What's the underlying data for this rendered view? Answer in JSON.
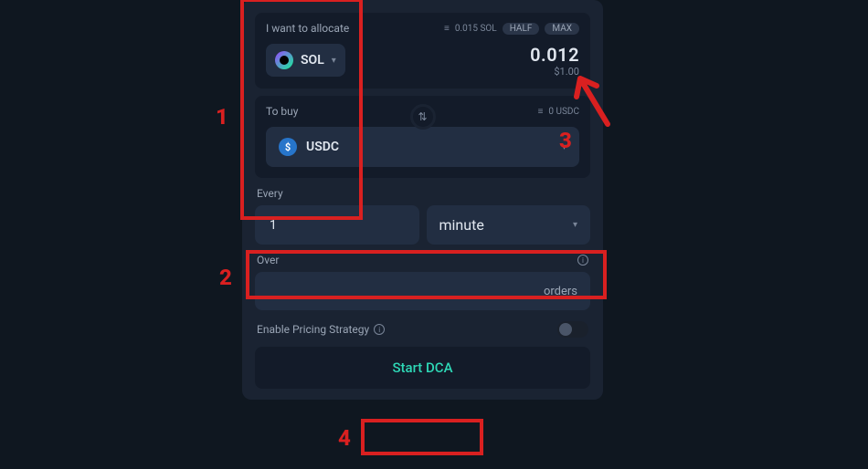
{
  "allocate": {
    "label": "I want to allocate",
    "balance_icon": "≡",
    "balance": "0.015 SOL",
    "half": "HALF",
    "max": "MAX",
    "token_symbol": "SOL",
    "amount": "0.012",
    "fiat": "$1.00"
  },
  "buy": {
    "label": "To buy",
    "balance_icon": "≡",
    "balance": "0 USDC",
    "token_symbol": "USDC"
  },
  "interval": {
    "label": "Every",
    "value": "1",
    "unit": "minute"
  },
  "over": {
    "label": "Over",
    "unit": "orders"
  },
  "pricing": {
    "label": "Enable Pricing Strategy"
  },
  "cta": "Start DCA",
  "annotations": {
    "n1": "1",
    "n2": "2",
    "n3": "3",
    "n4": "4"
  }
}
